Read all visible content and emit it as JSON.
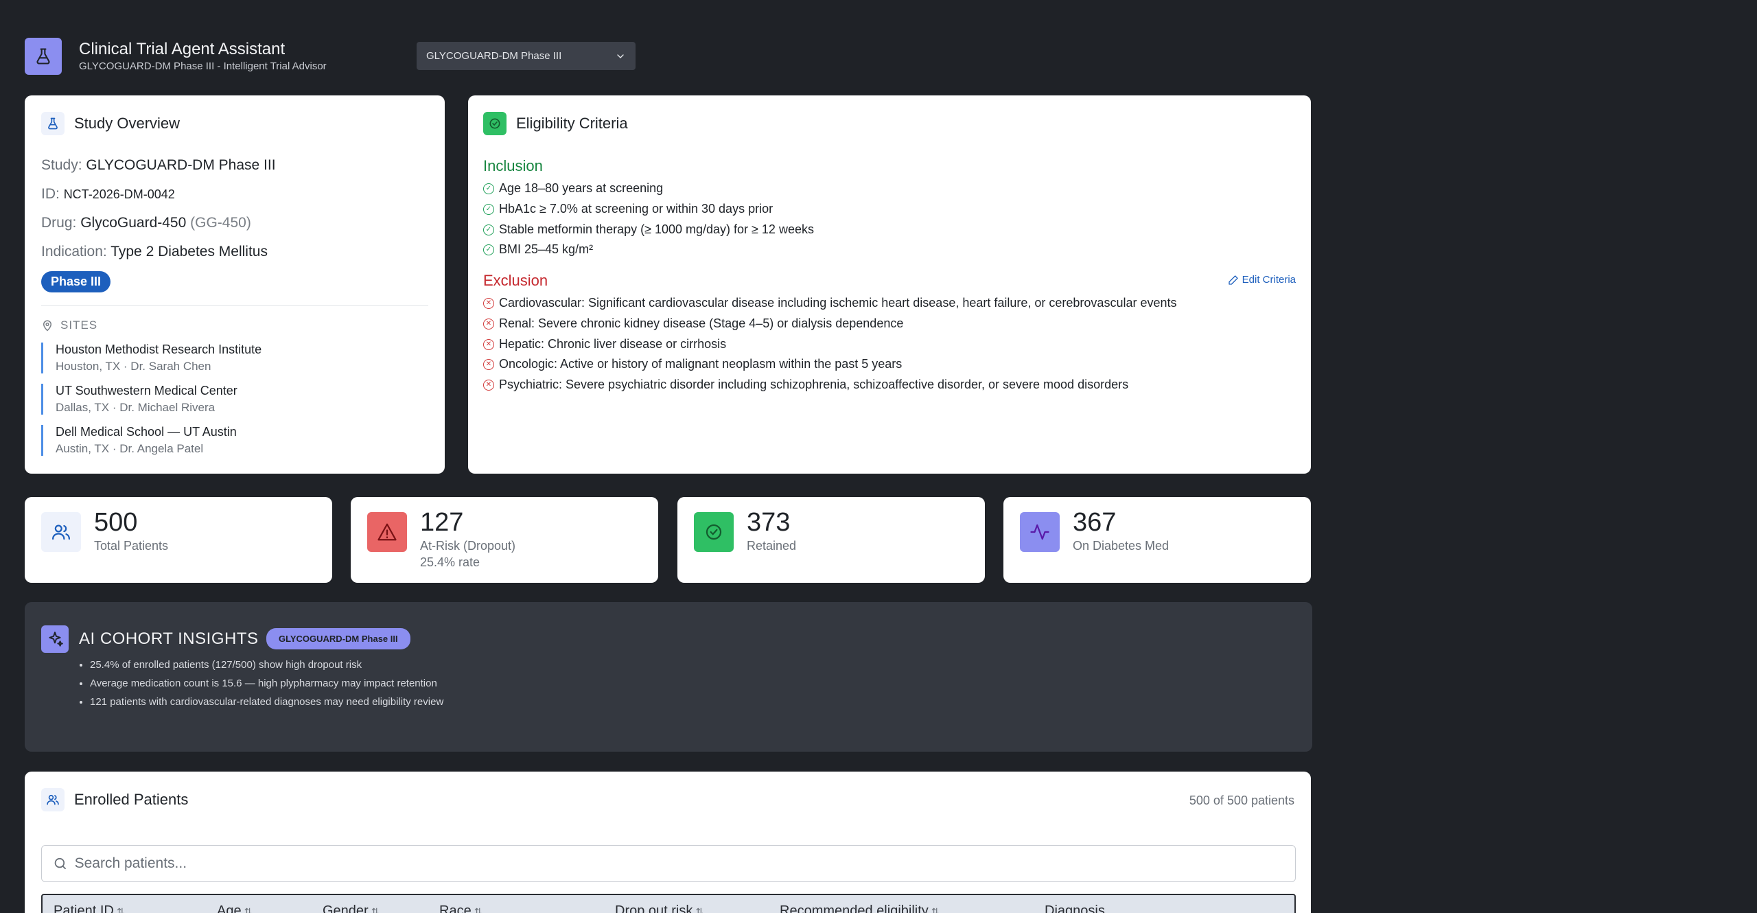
{
  "header": {
    "title": "Clinical Trial Agent Assistant",
    "subtitle": "GLYCOGUARD-DM Phase III - Intelligent Trial Advisor",
    "study_select": "GLYCOGUARD-DM Phase III"
  },
  "overview": {
    "title": "Study Overview",
    "study_label": "Study:",
    "study_value": "GLYCOGUARD-DM Phase III",
    "id_label": "ID:",
    "id_value": "NCT-2026-DM-0042",
    "drug_label": "Drug:",
    "drug_value": "GlycoGuard-450",
    "drug_code": "(GG-450)",
    "indication_label": "Indication:",
    "indication_value": "Type 2 Diabetes Mellitus",
    "phase": "Phase III",
    "sites_label": "SITES",
    "sites": [
      {
        "name": "Houston Methodist Research Institute",
        "detail": "Houston, TX · Dr. Sarah Chen"
      },
      {
        "name": "UT Southwestern Medical Center",
        "detail": "Dallas, TX · Dr. Michael Rivera"
      },
      {
        "name": "Dell Medical School — UT Austin",
        "detail": "Austin, TX · Dr. Angela Patel"
      }
    ]
  },
  "eligibility": {
    "title": "Eligibility Criteria",
    "inclusion_label": "Inclusion",
    "inclusion": [
      "Age 18–80 years at screening",
      "HbA1c ≥ 7.0% at screening or within 30 days prior",
      "Stable metformin therapy (≥ 1000 mg/day) for ≥ 12 weeks",
      "BMI 25–45 kg/m²"
    ],
    "exclusion_label": "Exclusion",
    "edit_label": "Edit Criteria",
    "exclusion": [
      "Cardiovascular: Significant cardiovascular disease including ischemic heart disease, heart failure, or cerebrovascular events",
      "Renal: Severe chronic kidney disease (Stage 4–5) or dialysis dependence",
      "Hepatic: Chronic liver disease or cirrhosis",
      "Oncologic: Active or history of malignant neoplasm within the past 5 years",
      "Psychiatric: Severe psychiatric disorder including schizophrenia, schizoaffective disorder, or severe mood disorders"
    ]
  },
  "stats": [
    {
      "value": "500",
      "label": "Total Patients",
      "sub": "",
      "icon": "users-icon",
      "color": "#eef2fb"
    },
    {
      "value": "127",
      "label": "At-Risk (Dropout)",
      "sub": "25.4% rate",
      "icon": "warning-icon",
      "color": "#e96565"
    },
    {
      "value": "373",
      "label": "Retained",
      "sub": "",
      "icon": "check-circle-icon",
      "color": "#2fbf64"
    },
    {
      "value": "367",
      "label": "On Diabetes Med",
      "sub": "",
      "icon": "activity-icon",
      "color": "#8b8ef0"
    }
  ],
  "insights": {
    "title": "AI COHORT INSIGHTS",
    "badge": "GLYCOGUARD-DM Phase III",
    "items": [
      "25.4% of enrolled patients (127/500) show high dropout risk",
      "Average medication count is 15.6 — high plypharmacy may impact retention",
      "121 patients with cardiovascular-related diagnoses may need eligibility review"
    ]
  },
  "patients": {
    "title": "Enrolled Patients",
    "count": "500 of 500 patients",
    "search_placeholder": "Search patients...",
    "columns": [
      "Patient ID",
      "Age",
      "Gender",
      "Race",
      "Drop out risk",
      "Recommended eligibility",
      "Diagnosis"
    ]
  }
}
